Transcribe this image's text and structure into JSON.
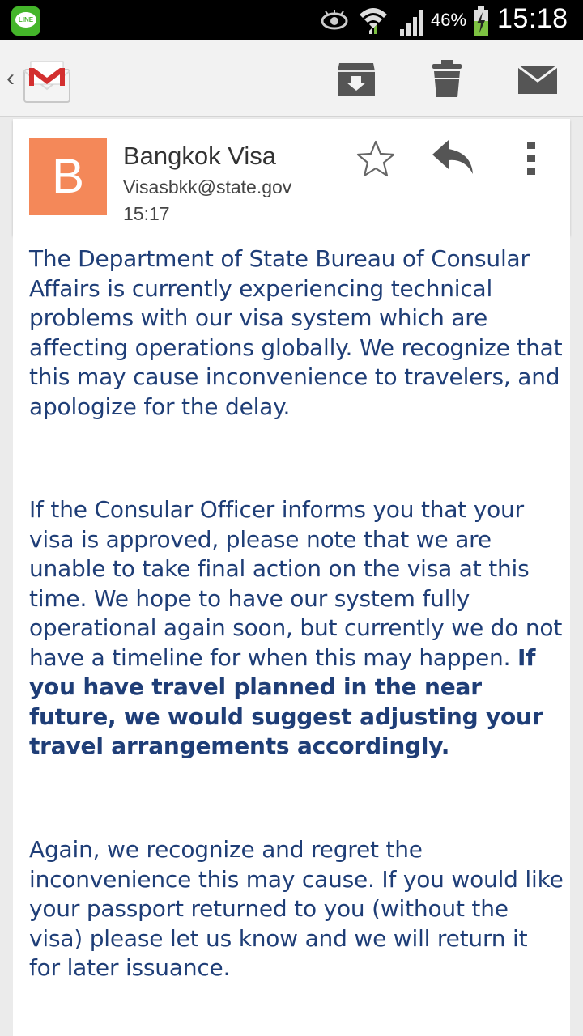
{
  "status_bar": {
    "app_icon": "line-app-icon",
    "app_label": "LINE",
    "battery": "46%",
    "time": "15:18"
  },
  "action_bar": {
    "back": "‹",
    "logo": "gmail-logo",
    "actions": [
      "archive-icon",
      "delete-icon",
      "mark-unread-icon"
    ]
  },
  "email": {
    "avatar_letter": "B",
    "avatar_color": "#f48859",
    "sender_name": "Bangkok Visa",
    "sender_email": "Visasbkk@state.gov",
    "time": "15:17",
    "paragraph1": "The Department of State Bureau of Consular Affairs is currently experiencing technical problems with our visa system which are affecting operations globally.   We recognize that this may cause inconvenience to travelers, and apologize for the delay.",
    "paragraph2": "If the Consular Officer informs you that your visa is approved, please note that we are unable to take final action on the visa at this time. We hope to have our system fully operational again soon, but currently we do not have a timeline for when this may happen. ",
    "paragraph2_bold": "If you have travel planned in the near future, we would suggest adjusting your travel arrangements accordingly.",
    "paragraph3": "Again, we recognize and regret the inconvenience this may cause.  If you would like your passport returned to you (without the visa) please let us know and we will return it for later issuance."
  },
  "colors": {
    "body_text": "#1f3e77",
    "status_bar": "#000000",
    "action_bar": "#f2f2f2"
  }
}
